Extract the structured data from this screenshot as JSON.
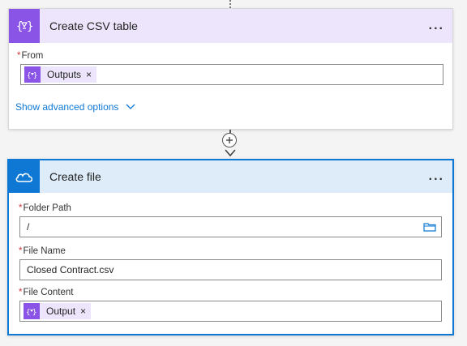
{
  "csv_card": {
    "title": "Create CSV table",
    "more": "...",
    "from_label": "From",
    "from_token": "Outputs",
    "advanced": "Show advanced options"
  },
  "file_card": {
    "title": "Create file",
    "more": "...",
    "folder_label": "Folder Path",
    "folder_value": "/",
    "name_label": "File Name",
    "name_value": "Closed Contract.csv",
    "content_label": "File Content",
    "content_token": "Output"
  },
  "required_mark": "*",
  "remove_mark": "×",
  "colors": {
    "accent_purple": "#8a55e6",
    "accent_blue": "#0f78d4",
    "required": "#d13438"
  },
  "icons": [
    "data-operations-icon",
    "onedrive-cloud-icon",
    "folder-icon",
    "chevron-down-icon",
    "plus-icon",
    "arrow-down-icon"
  ]
}
